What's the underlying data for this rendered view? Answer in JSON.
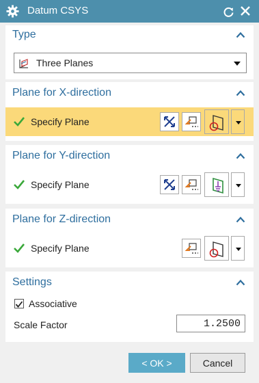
{
  "window": {
    "title": "Datum CSYS",
    "icon": "gear-icon"
  },
  "colors": {
    "titlebar": "#4d8fac",
    "section_title": "#2e6e9e",
    "highlight": "#fbd97a",
    "ok_button": "#5aaac8",
    "check": "#3aa83a"
  },
  "type_section": {
    "title": "Type",
    "selected": "Three Planes"
  },
  "x_section": {
    "title": "Plane for X-direction",
    "label": "Specify Plane"
  },
  "y_section": {
    "title": "Plane for Y-direction",
    "label": "Specify Plane"
  },
  "z_section": {
    "title": "Plane for Z-direction",
    "label": "Specify Plane"
  },
  "settings": {
    "title": "Settings",
    "associative_label": "Associative",
    "associative_checked": true,
    "scale_label": "Scale Factor",
    "scale_value": "1.2500"
  },
  "footer": {
    "ok_label": "< OK >",
    "cancel_label": "Cancel"
  }
}
